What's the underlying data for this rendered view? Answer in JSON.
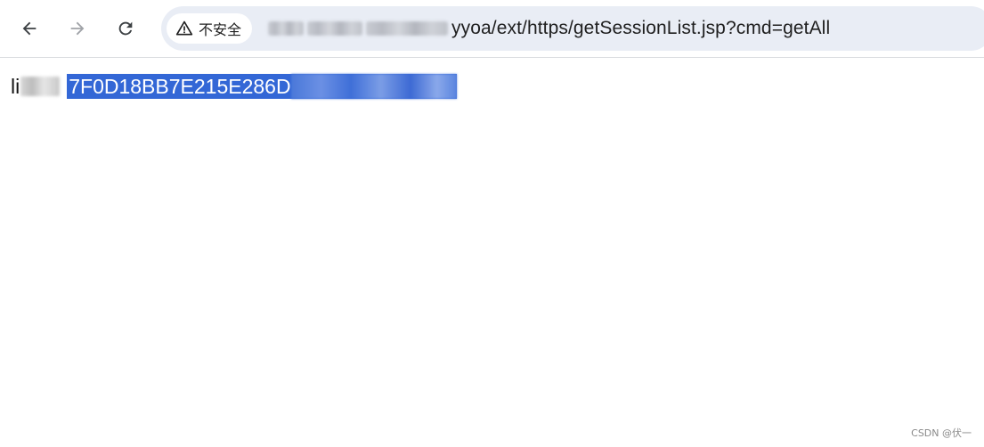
{
  "browser": {
    "nav": {
      "back_icon": "arrow-left-icon",
      "forward_icon": "arrow-right-icon",
      "reload_icon": "reload-icon"
    },
    "address_bar": {
      "security_icon": "warning-triangle-icon",
      "security_label": "不安全",
      "url_visible": "yyoa/ext/https/getSessionList.jsp?cmd=getAll"
    }
  },
  "page": {
    "key_visible": "li",
    "session_id_visible": "7F0D18BB7E215E286D",
    "selection_color": "#3367d6"
  },
  "watermark": {
    "text": "CSDN @伏一"
  }
}
